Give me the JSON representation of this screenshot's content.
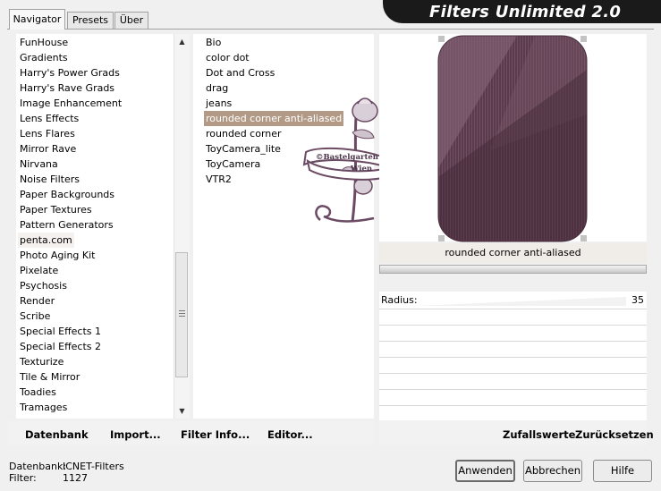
{
  "title": "Filters Unlimited 2.0",
  "tabs": [
    {
      "label": "Navigator",
      "active": true
    },
    {
      "label": "Presets",
      "active": false
    },
    {
      "label": "Über",
      "active": false
    }
  ],
  "categories": [
    "FunHouse",
    "Gradients",
    "Harry's Power Grads",
    "Harry's Rave Grads",
    "Image Enhancement",
    "Lens Effects",
    "Lens Flares",
    "Mirror Rave",
    "Nirvana",
    "Noise Filters",
    "Paper Backgrounds",
    "Paper Textures",
    "Pattern Generators",
    "penta.com",
    "Photo Aging Kit",
    "Pixelate",
    "Psychosis",
    "Render",
    "Scribe",
    "Special Effects 1",
    "Special Effects 2",
    "Texturize",
    "Tile & Mirror",
    "Toadies",
    "Tramages"
  ],
  "highlighted_category": "penta.com",
  "filters": [
    "Bio",
    "color dot",
    "Dot and Cross",
    "drag",
    "jeans",
    "rounded corner anti-aliased",
    "rounded corner",
    "ToyCamera_lite",
    "ToyCamera",
    "VTR2"
  ],
  "selected_filter": "rounded corner anti-aliased",
  "watermark": {
    "line1": "©Bastelgarten",
    "line2": "Wien"
  },
  "preview": {
    "filter_name": "rounded corner anti-aliased",
    "base_color": "#553344"
  },
  "params": [
    {
      "label": "Radius:",
      "value": "35"
    }
  ],
  "left_buttons": {
    "database": "Datenbank",
    "import": "Import...",
    "filter_info": "Filter Info...",
    "editor": "Editor..."
  },
  "right_buttons": {
    "randomize": "Zufallswerte",
    "reset": "Zurücksetzen"
  },
  "status": {
    "database_label": "Datenbank:",
    "database_value": "ICNET-Filters",
    "filter_label": "Filter:",
    "filter_value": "1127"
  },
  "dialog_buttons": {
    "apply": "Anwenden",
    "cancel": "Abbrechen",
    "help": "Hilfe"
  }
}
